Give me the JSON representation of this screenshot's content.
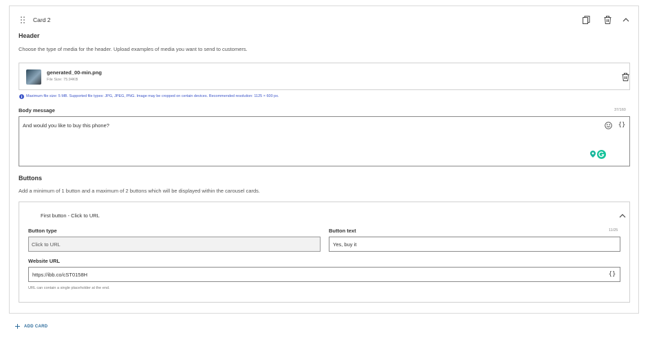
{
  "card": {
    "title": "Card 2"
  },
  "header": {
    "title": "Header",
    "description": "Choose the type of media for the header. Upload examples of media you want to send to customers.",
    "file_name": "generated_00-min.png",
    "file_size": "File Size: 75.94KB",
    "info": "Maximum file size: 5 MB. Supported file types: JPG, JPEG, PNG. Image may be cropped on certain devices. Recommended resolution: 1125 × 600 px."
  },
  "body": {
    "label": "Body message",
    "count": "37/160",
    "value": "And would you like to buy this phone?",
    "placeholder_icon": "{}"
  },
  "buttons": {
    "title": "Buttons",
    "description": "Add a minimum of 1 button and a maximum of 2 buttons which will be displayed within the carousel cards.",
    "first": {
      "title": "First button - Click to URL",
      "type_label": "Button type",
      "type_value": "Click to URL",
      "text_label": "Button text",
      "text_count": "11/25",
      "text_value": "Yes, buy it",
      "url_label": "Website URL",
      "url_value": "https://ibb.co/cST0158H",
      "url_hint": "URL can contain a single placeholder at the end.",
      "placeholder_icon": "{}"
    }
  },
  "footer": {
    "add_card": "ADD CARD"
  },
  "colors": {
    "link": "#2a6a9a",
    "info": "#3c55c8",
    "grammarly": "#15c39a"
  },
  "icons": [
    "drag-handle-icon",
    "copy-icon",
    "trash-icon",
    "chevron-up-icon",
    "info-icon",
    "emoji-icon",
    "braces-icon",
    "location-pin-icon",
    "grammarly-icon",
    "plus-icon"
  ]
}
